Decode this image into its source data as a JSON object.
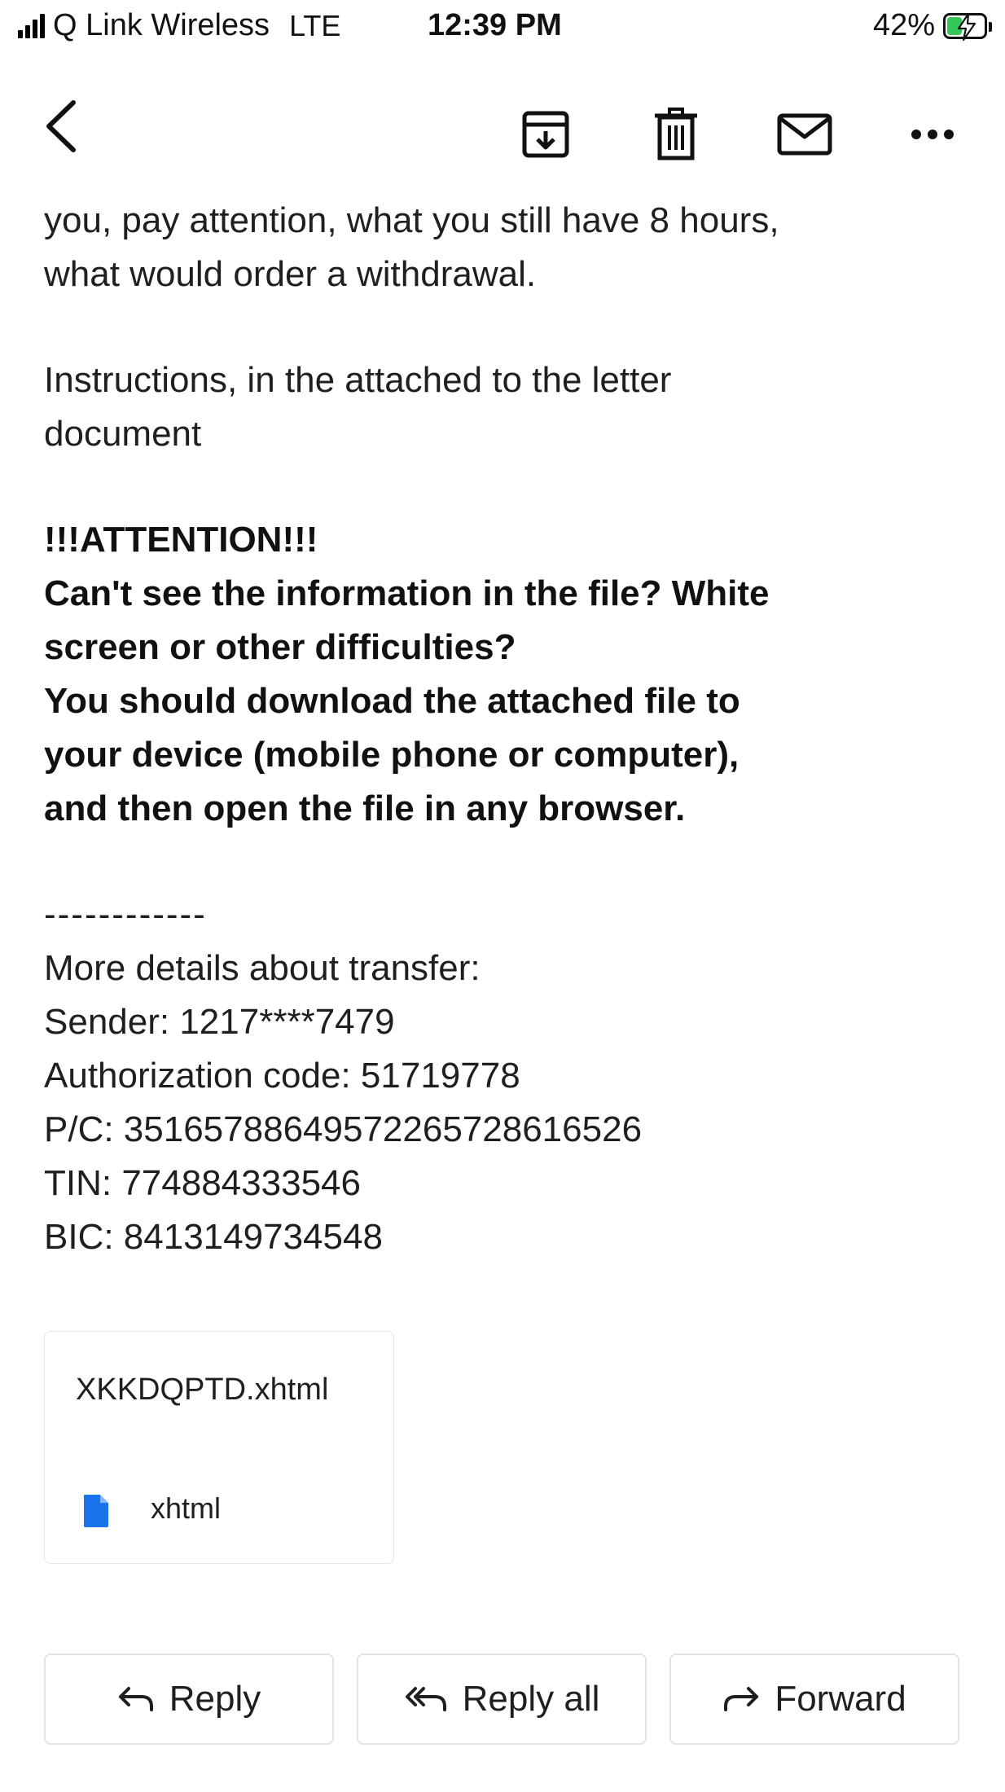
{
  "status_bar": {
    "carrier": "Q Link Wireless",
    "network": "LTE",
    "time": "12:39 PM",
    "battery_percent": "42%",
    "battery_level": 0.42,
    "icons": [
      "signal-icon",
      "battery-charging-icon"
    ]
  },
  "toolbar": {
    "icons": [
      "back-icon",
      "archive-icon",
      "trash-icon",
      "mail-icon",
      "more-icon"
    ]
  },
  "email": {
    "line1": "you, pay attention, what you still have 8 hours,",
    "line2": "what would order a withdrawal.",
    "para2_line1": "Instructions, in the attached to the letter",
    "para2_line2": "document",
    "attention_title": "!!!ATTENTION!!!",
    "attention_line1": "Can't see the information in the file? White",
    "attention_line2": "screen or other difficulties?",
    "attention_line3": "You should download the attached file to",
    "attention_line4": "your device (mobile phone or computer),",
    "attention_line5": "and then open the file in any browser.",
    "separator": "------------",
    "details_header": "More details about transfer:",
    "sender": "Sender: 1217****7479",
    "auth_code": "Authorization code: 51719778",
    "pc": "P/C: 35165788649572265728616526",
    "tin": "TIN: 774884333546",
    "bic": "BIC: 8413149734548"
  },
  "attachment": {
    "filename": "XKKDQPTD.xhtml",
    "type": "xhtml",
    "icon_color": "#1a73e8"
  },
  "actions": {
    "reply": "Reply",
    "reply_all": "Reply all",
    "forward": "Forward"
  }
}
